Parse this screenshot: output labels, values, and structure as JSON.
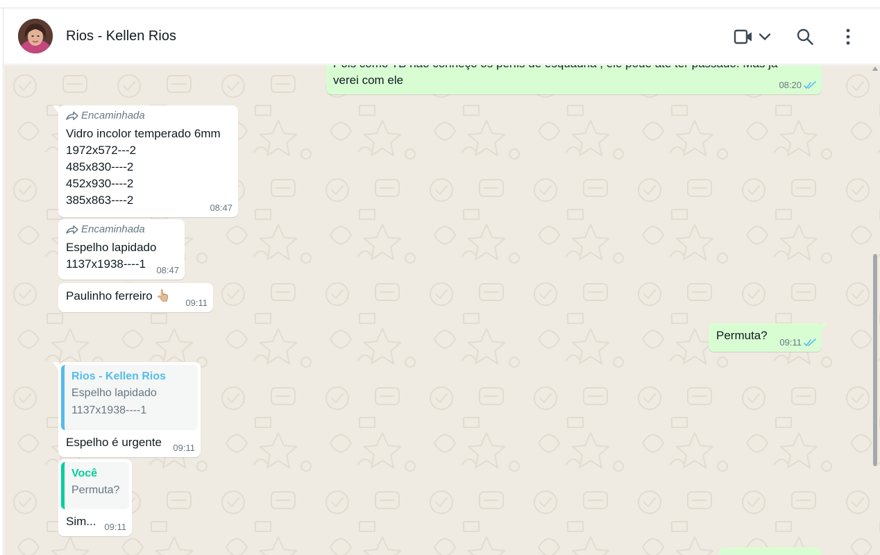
{
  "header": {
    "contact_name": "Rios - Kellen Rios",
    "icons": [
      "video-call-icon",
      "chevron-down-icon",
      "search-icon",
      "menu-icon"
    ]
  },
  "colors": {
    "chat_bg": "#efeae2",
    "incoming_bubble": "#ffffff",
    "outgoing_bubble": "#d9fdd3",
    "read_ticks": "#53bdeb",
    "meta_text": "#667781",
    "quote_contact": "#53bdeb",
    "quote_self": "#06cf9c"
  },
  "messages": [
    {
      "direction": "out",
      "lines": [
        "Pois como TB não conheço os perfis de esquadria , ele pode até ter passado. Mas já",
        "verei com ele"
      ],
      "time": "08:20",
      "read": true
    },
    {
      "direction": "in",
      "forwarded_label": "Encaminhada",
      "lines": [
        "Vidro incolor temperado 6mm",
        "1972x572---2",
        "485x830----2",
        "452x930----2",
        "385x863----2"
      ],
      "time": "08:47"
    },
    {
      "direction": "in",
      "forwarded_label": "Encaminhada",
      "lines": [
        "Espelho lapidado",
        "1137x1938----1"
      ],
      "time": "08:47"
    },
    {
      "direction": "in",
      "text": "Paulinho ferreiro 👆🏼",
      "time": "09:11"
    },
    {
      "direction": "out",
      "text": "Permuta?",
      "time": "09:11",
      "read": true
    },
    {
      "direction": "in",
      "quote": {
        "author": "Rios - Kellen Rios",
        "lines": [
          "Espelho lapidado",
          "1137x1938----1"
        ]
      },
      "text": "Espelho é urgente",
      "time": "09:11"
    },
    {
      "direction": "in",
      "quote": {
        "author": "Você",
        "lines": [
          "Permuta?"
        ]
      },
      "text": "Sim...",
      "time": "09:11"
    }
  ]
}
